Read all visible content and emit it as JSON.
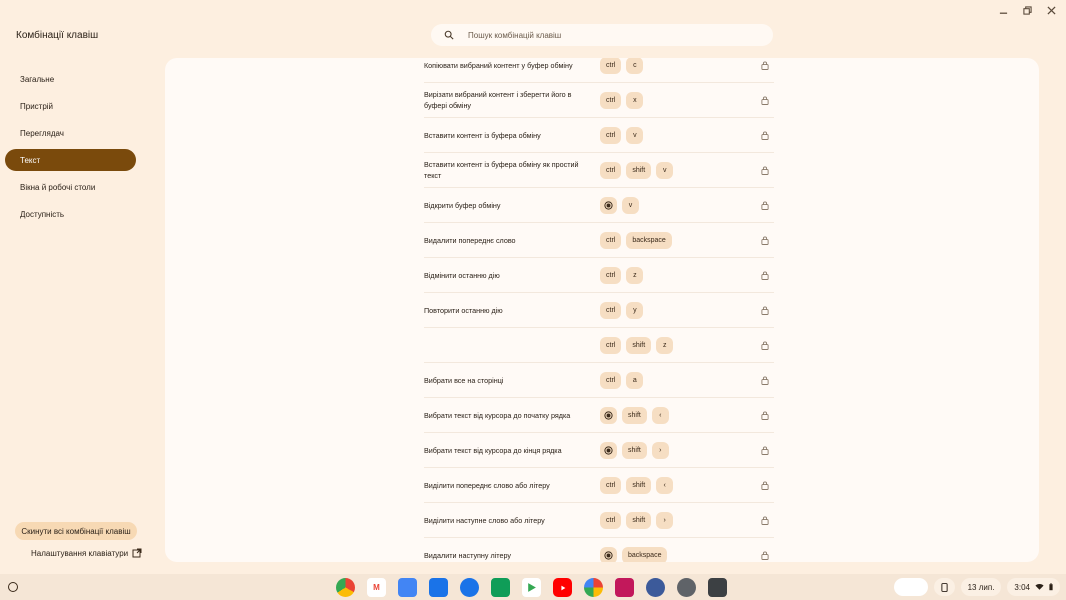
{
  "app": {
    "title": "Комбінації клавіш"
  },
  "search": {
    "placeholder": "Пошук комбінацій клавіш"
  },
  "sidebar": {
    "items": [
      {
        "label": "Загальне",
        "active": false
      },
      {
        "label": "Пристрій",
        "active": false
      },
      {
        "label": "Переглядач",
        "active": false
      },
      {
        "label": "Текст",
        "active": true
      },
      {
        "label": "Вікна й робочі столи",
        "active": false
      },
      {
        "label": "Доступність",
        "active": false
      }
    ],
    "reset_label": "Скинути всі комбінації клавіш",
    "keyboard_settings_label": "Налаштування клавіатури"
  },
  "shortcuts": [
    {
      "desc": "Копіювати вибраний контент у буфер обміну",
      "keys": [
        "ctrl",
        "c"
      ]
    },
    {
      "desc": "Вирізати вибраний контент і зберегти його в буфері обміну",
      "keys": [
        "ctrl",
        "x"
      ]
    },
    {
      "desc": "Вставити контент із буфера обміну",
      "keys": [
        "ctrl",
        "v"
      ]
    },
    {
      "desc": "Вставити контент із буфера обміну як простий текст",
      "keys": [
        "ctrl",
        "shift",
        "v"
      ]
    },
    {
      "desc": "Відкрити буфер обміну",
      "keys": [
        "launcher",
        "v"
      ]
    },
    {
      "desc": "Видалити попереднє слово",
      "keys": [
        "ctrl",
        "backspace"
      ]
    },
    {
      "desc": "Відмінити останню дію",
      "keys": [
        "ctrl",
        "z"
      ]
    },
    {
      "desc": "Повторити останню дію",
      "keys": [
        "ctrl",
        "y"
      ]
    },
    {
      "desc": "",
      "keys": [
        "ctrl",
        "shift",
        "z"
      ]
    },
    {
      "desc": "Вибрати все на сторінці",
      "keys": [
        "ctrl",
        "a"
      ]
    },
    {
      "desc": "Вибрати текст від курсора до початку рядка",
      "keys": [
        "launcher",
        "shift",
        "‹"
      ]
    },
    {
      "desc": "Вибрати текст від курсора до кінця рядка",
      "keys": [
        "launcher",
        "shift",
        "›"
      ]
    },
    {
      "desc": "Виділити попереднє слово або літеру",
      "keys": [
        "ctrl",
        "shift",
        "‹"
      ]
    },
    {
      "desc": "Виділити наступне слово або літеру",
      "keys": [
        "ctrl",
        "shift",
        "›"
      ]
    },
    {
      "desc": "Видалити наступну літеру",
      "keys": [
        "launcher",
        "backspace"
      ]
    }
  ],
  "shelf": {
    "date": "13 лип.",
    "time": "3:04"
  },
  "colors": {
    "background": "#fdefe0",
    "active_nav": "#7a4a0c",
    "key_chip": "#f6dec3",
    "content_bg": "#fffaf6"
  }
}
